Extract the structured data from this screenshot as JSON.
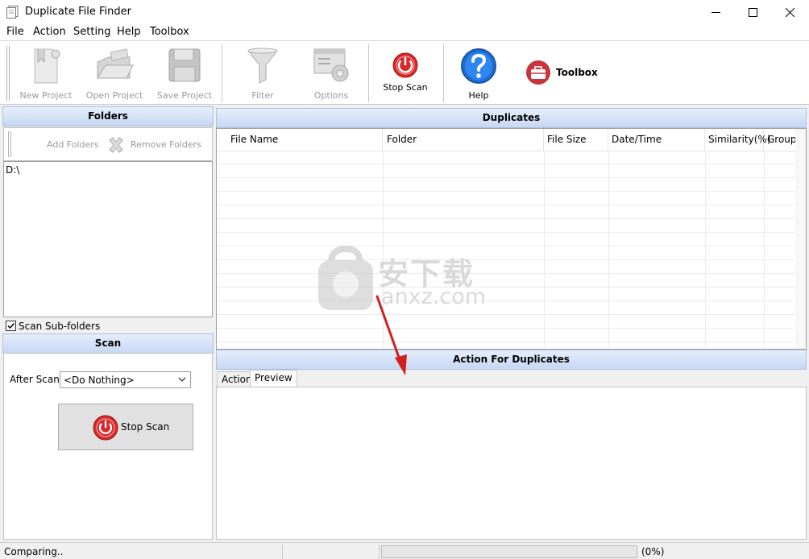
{
  "window": {
    "title": "Duplicate File Finder"
  },
  "menu": [
    "File",
    "Action",
    "Setting",
    "Help",
    "Toolbox"
  ],
  "toolbar": {
    "new_project": "New Project",
    "open_project": "Open Project",
    "save_project": "Save Project",
    "filter": "Filter",
    "options": "Options",
    "stop_scan": "Stop Scan",
    "help": "Help",
    "toolbox": "Toolbox"
  },
  "folders": {
    "header": "Folders",
    "add": "Add Folders",
    "remove": "Remove Folders",
    "items": [
      "D:\\"
    ],
    "scan_subfolders": "Scan Sub-folders",
    "scan_subfolders_checked": true
  },
  "scan": {
    "header": "Scan",
    "after_scan_label": "After Scan:",
    "after_scan_value": "<Do Nothing>",
    "stop_button": "Stop Scan"
  },
  "duplicates": {
    "header": "Duplicates",
    "columns": [
      "File Name",
      "Folder",
      "File Size",
      "Date/Time",
      "Similarity(%)",
      "Group"
    ]
  },
  "actions": {
    "header": "Action For Duplicates",
    "tabs": [
      "Action",
      "Preview"
    ],
    "active_tab": "Preview"
  },
  "status": {
    "text": "Comparing..",
    "progress_percent": 0,
    "progress_text": "(0%)"
  },
  "watermark": {
    "cn": "安下载",
    "en": "anxz.com"
  },
  "colors": {
    "header_gradient_top": "#e5eefc",
    "header_gradient_bottom": "#c7d8f3",
    "stop_red": "#d9292b",
    "help_blue": "#1d6fd6",
    "arrow_red": "#d41f1f"
  }
}
